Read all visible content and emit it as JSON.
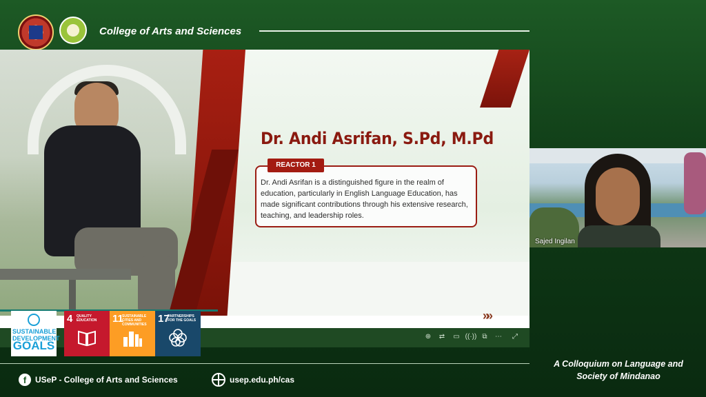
{
  "header": {
    "title": "College of Arts and Sciences"
  },
  "slide": {
    "speaker_name": "Dr. Andi Asrifan, S.Pd, M.Pd",
    "role_badge": "REACTOR 1",
    "bio": "Dr. Andi Asrifan is a distinguished figure in the realm of education, particularly in English Language Education, has made significant contributions through his extensive research, teaching, and leadership roles.",
    "next_glyph": "»»",
    "toolbar": [
      {
        "icon": "zoom-icon",
        "glyph": "⊕"
      },
      {
        "icon": "share-icon",
        "glyph": "⇄"
      },
      {
        "icon": "subtitles-icon",
        "glyph": "▭"
      },
      {
        "icon": "broadcast-icon",
        "glyph": "((·))"
      },
      {
        "icon": "slides-icon",
        "glyph": "⧉"
      },
      {
        "icon": "more-icon",
        "glyph": "⋯"
      },
      {
        "icon": "expand-icon",
        "glyph": "⤢"
      }
    ]
  },
  "sdg": {
    "logo_line1": "SUSTAINABLE DEVELOPMENT",
    "logo_line2": "GOALS",
    "tiles": [
      {
        "number": "4",
        "label": "QUALITY EDUCATION",
        "color": "#c5192d"
      },
      {
        "number": "11",
        "label": "SUSTAINABLE CITIES AND COMMUNITIES",
        "color": "#fd9d24"
      },
      {
        "number": "17",
        "label": "PARTNERSHIPS FOR THE GOALS",
        "color": "#19486a"
      }
    ]
  },
  "participant": {
    "name": "Sajed Ingilan"
  },
  "footer": {
    "facebook_label": "USeP - College of Arts and Sciences",
    "website": "usep.edu.ph/cas",
    "event_title": "A Colloquium on Language and Society of Mindanao"
  },
  "colors": {
    "brand_green": "#1d5a25",
    "accent_red": "#9a1c12"
  }
}
